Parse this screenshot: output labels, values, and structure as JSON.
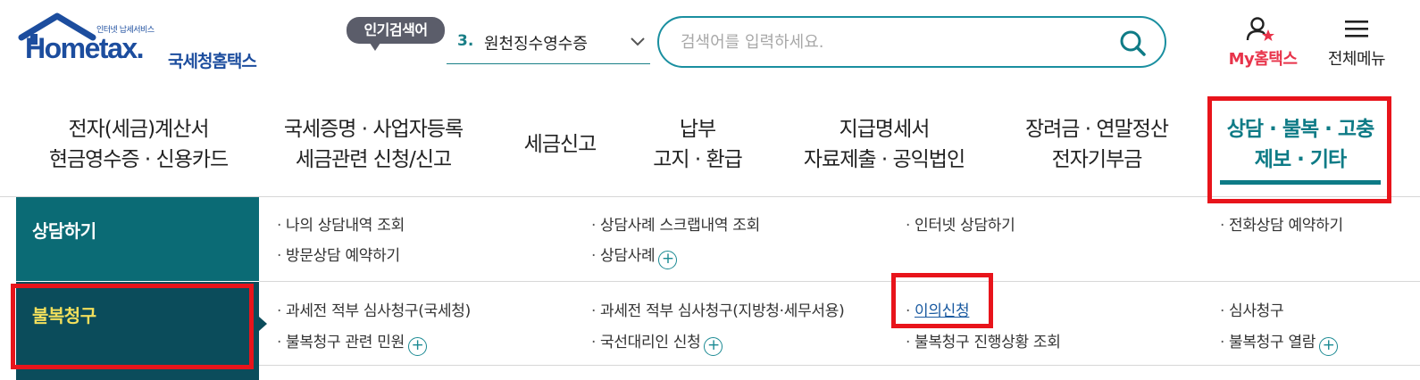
{
  "header": {
    "logo_tagline": "인터넷 납세서비스",
    "logo_en": "Hometax.",
    "logo_ko": "국세청홈택스",
    "popular_badge": "인기검색어",
    "popular_rank": "3.",
    "popular_term": "원천징수영수증",
    "search_placeholder": "검색어를 입력하세요.",
    "my_hometax": "My홈택스",
    "all_menu": "전체메뉴"
  },
  "gnb": [
    {
      "line1": "전자(세금)계산서",
      "line2": "현금영수증 · 신용카드"
    },
    {
      "line1": "국세증명 · 사업자등록",
      "line2": "세금관련 신청/신고"
    },
    {
      "line1": "세금신고",
      "line2": ""
    },
    {
      "line1": "납부",
      "line2": "고지 · 환급"
    },
    {
      "line1": "지급명세서",
      "line2": "자료제출 · 공익법인"
    },
    {
      "line1": "장려금 · 연말정산",
      "line2": "전자기부금"
    },
    {
      "line1": "상담 · 불복 · 고충",
      "line2": "제보 · 기타"
    }
  ],
  "submenu": {
    "consult": {
      "title": "상담하기",
      "links": [
        "나의 상담내역 조회",
        "상담사례 스크랩내역 조회",
        "인터넷 상담하기",
        "전화상담 예약하기",
        "방문상담 예약하기",
        "상담사례"
      ]
    },
    "appeal": {
      "title": "불복청구",
      "links": [
        "과세전 적부 심사청구(국세청)",
        "과세전 적부 심사청구(지방청·세무서용)",
        "이의신청",
        "심사청구",
        "불복청구 관련 민원",
        "국선대리인 신청",
        "불복청구 진행상황 조회",
        "불복청구 열람"
      ]
    }
  },
  "colors": {
    "brand_blue": "#1c4d9e",
    "teal": "#0e7b86",
    "highlight_red": "#e8141b",
    "accent_pink": "#e8334a"
  }
}
